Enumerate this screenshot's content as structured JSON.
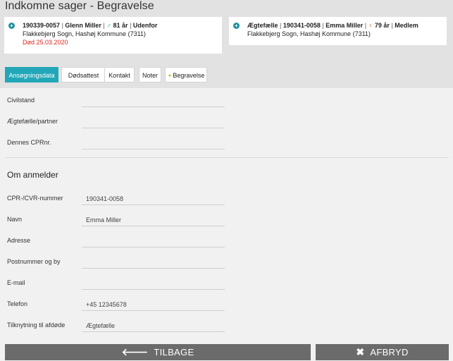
{
  "page": {
    "title": "Indkomne sager - Begravelse"
  },
  "deceased": {
    "cpr": "190339-0057",
    "name": "Glenn Miller",
    "age": "81 år",
    "location": "Udenfor",
    "parish": "Flakkebjerg Sogn, Hashøj Kommune (7311)",
    "death": "Død 25.03.2020"
  },
  "spouse": {
    "relation": "Ægtefælle",
    "cpr": "190341-0058",
    "name": "Emma Miller",
    "age": "79 år",
    "status": "Medlem",
    "parish": "Flakkebjerg Sogn, Hashøj Kommune (7311)"
  },
  "tabs": [
    {
      "label": "Ansøgningsdata",
      "active": true
    },
    {
      "label": "Dødsattest",
      "active": false
    },
    {
      "label": "Kontakt",
      "active": false
    },
    {
      "label": "Noter",
      "active": false
    },
    {
      "label": "Begravelse",
      "active": false
    }
  ],
  "form": {
    "fields_top": [
      {
        "label": "Civilstand",
        "value": ""
      },
      {
        "label": "Ægtefælle/partner",
        "value": ""
      },
      {
        "label": "Dennes CPRnr.",
        "value": ""
      }
    ],
    "reporter_section_title": "Om anmelder",
    "reporter_fields": [
      {
        "label": "CPR-/CVR-nummer",
        "value": "190341-0058"
      },
      {
        "label": "Navn",
        "value": "Emma Miller"
      },
      {
        "label": "Adresse",
        "value": ""
      },
      {
        "label": "Postnummer og by",
        "value": ""
      },
      {
        "label": "E-mail",
        "value": ""
      },
      {
        "label": "Telefon",
        "value": "+45 12345678"
      },
      {
        "label": "Tilknytning til afdøde",
        "value": "Ægtefælle"
      }
    ]
  },
  "footer": {
    "back_label": "TILBAGE",
    "cancel_label": "AFBRYD"
  },
  "colors": {
    "accent": "#22a7b8",
    "button": "#6b6b6b",
    "death": "#e0241c"
  },
  "icons": {
    "card_expand": "plus-circle-icon",
    "male": "male-person-icon",
    "female": "female-person-icon",
    "back": "arrow-left-icon",
    "cancel": "close-icon",
    "tab_marker": "star-icon"
  }
}
